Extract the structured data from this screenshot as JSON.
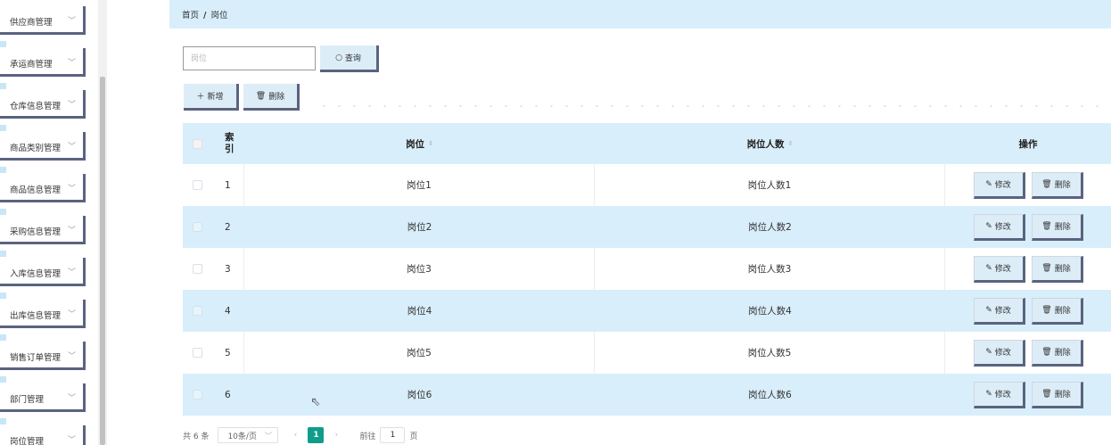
{
  "sidebar": {
    "items": [
      {
        "label": "供应商管理"
      },
      {
        "label": "承运商管理"
      },
      {
        "label": "仓库信息管理"
      },
      {
        "label": "商品类别管理"
      },
      {
        "label": "商品信息管理"
      },
      {
        "label": "采购信息管理"
      },
      {
        "label": "入库信息管理"
      },
      {
        "label": "出库信息管理"
      },
      {
        "label": "销售订单管理"
      },
      {
        "label": "部门管理"
      },
      {
        "label": "岗位管理"
      }
    ]
  },
  "breadcrumb": {
    "home": "首页",
    "separator": "/",
    "current": "岗位"
  },
  "search": {
    "placeholder": "岗位",
    "value": ""
  },
  "toolbar": {
    "query_label": "查询",
    "add_label": "新增",
    "delete_label": "删除"
  },
  "table": {
    "headers": {
      "index": "索引",
      "position": "岗位",
      "count": "岗位人数",
      "actions": "操作"
    },
    "rows": [
      {
        "index": "1",
        "position": "岗位1",
        "count": "岗位人数1"
      },
      {
        "index": "2",
        "position": "岗位2",
        "count": "岗位人数2"
      },
      {
        "index": "3",
        "position": "岗位3",
        "count": "岗位人数3"
      },
      {
        "index": "4",
        "position": "岗位4",
        "count": "岗位人数4"
      },
      {
        "index": "5",
        "position": "岗位5",
        "count": "岗位人数5"
      },
      {
        "index": "6",
        "position": "岗位6",
        "count": "岗位人数6"
      }
    ],
    "edit_label": "修改",
    "delete_label": "删除"
  },
  "pagination": {
    "total": "共 6 条",
    "page_size": "10条/页",
    "current_page": "1",
    "goto_prefix": "前往",
    "goto_value": "1",
    "goto_suffix": "页"
  },
  "colors": {
    "accent": "#0f9d8a",
    "header_bg": "#d9eefb",
    "button_border": "#5a6380"
  }
}
